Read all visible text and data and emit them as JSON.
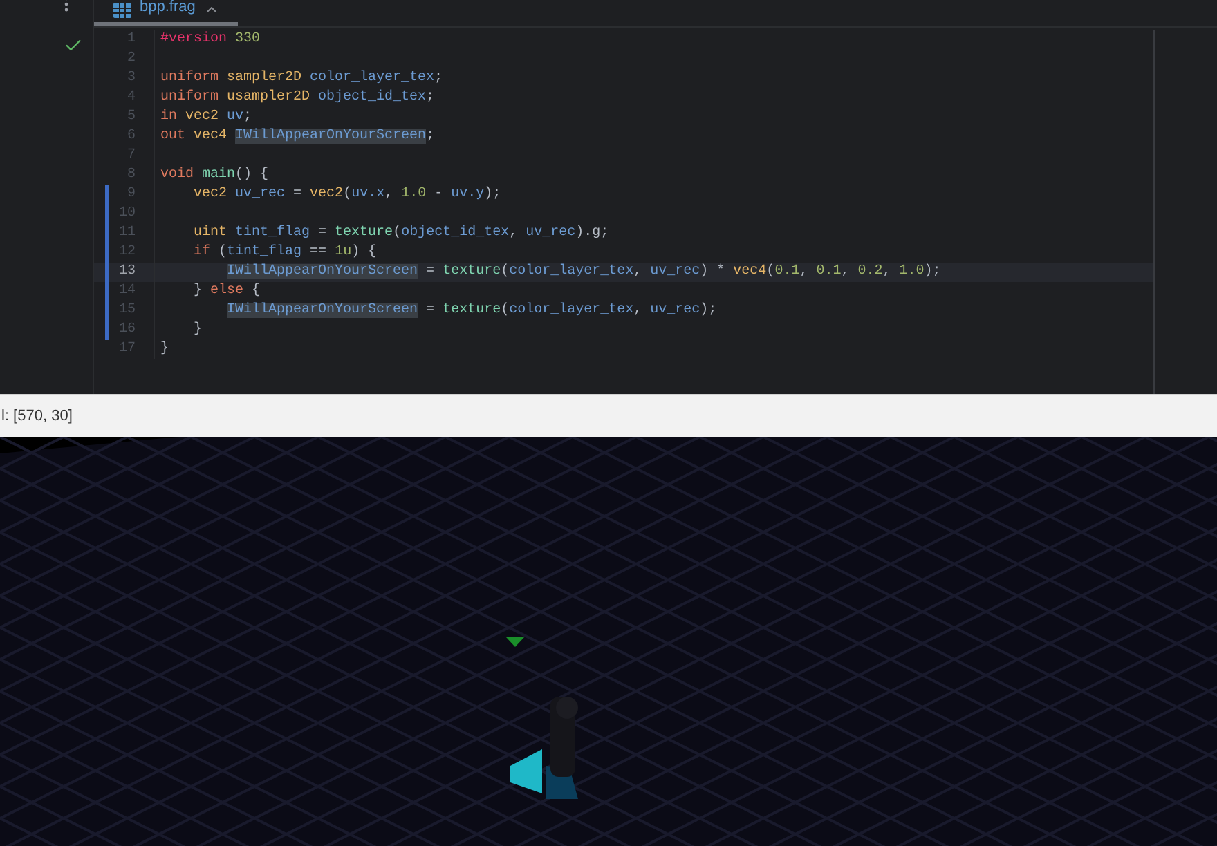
{
  "tab": {
    "title": "bpp.frag",
    "selected": true
  },
  "code_lines": [
    {
      "number": "1",
      "current": false,
      "changed": false,
      "tokens": [
        {
          "text": "#version ",
          "kind": "directive"
        },
        {
          "text": "330",
          "kind": "num"
        }
      ]
    },
    {
      "number": "2",
      "current": false,
      "changed": false
    },
    {
      "number": "3",
      "current": false,
      "changed": false,
      "tokens": [
        {
          "text": "uniform ",
          "kind": "kw"
        },
        {
          "text": "sampler2D ",
          "kind": "type"
        },
        {
          "text": "color_layer_tex",
          "kind": "id"
        },
        {
          "text": ";",
          "kind": "p"
        }
      ]
    },
    {
      "number": "4",
      "current": false,
      "changed": false,
      "tokens": [
        {
          "text": "uniform ",
          "kind": "kw"
        },
        {
          "text": "usampler2D ",
          "kind": "type"
        },
        {
          "text": "object_id_tex",
          "kind": "id"
        },
        {
          "text": ";",
          "kind": "p"
        }
      ]
    },
    {
      "number": "5",
      "current": false,
      "changed": false,
      "tokens": [
        {
          "text": "in ",
          "kind": "kw"
        },
        {
          "text": "vec2 ",
          "kind": "type"
        },
        {
          "text": "uv",
          "kind": "id"
        },
        {
          "text": ";",
          "kind": "p"
        }
      ]
    },
    {
      "number": "6",
      "current": false,
      "changed": false,
      "tokens": [
        {
          "text": "out ",
          "kind": "kw"
        },
        {
          "text": "vec4 ",
          "kind": "type"
        },
        {
          "text": "IWillAppearOnYourScreen",
          "kind": "mark"
        },
        {
          "text": ";",
          "kind": "p"
        }
      ]
    },
    {
      "number": "7",
      "current": false,
      "changed": false
    },
    {
      "number": "8",
      "current": false,
      "changed": false,
      "tokens": [
        {
          "text": "void ",
          "kind": "kw"
        },
        {
          "text": "main",
          "kind": "func"
        },
        {
          "text": "() {",
          "kind": "p"
        }
      ]
    },
    {
      "number": "9",
      "current": false,
      "changed": true,
      "tokens": [
        {
          "text": "    vec2 ",
          "kind": "type"
        },
        {
          "text": "uv_rec",
          "kind": "id"
        },
        {
          "text": " = ",
          "kind": "p"
        },
        {
          "text": "vec2",
          "kind": "type"
        },
        {
          "text": "(",
          "kind": "p"
        },
        {
          "text": "uv.x",
          "kind": "id"
        },
        {
          "text": ", ",
          "kind": "p"
        },
        {
          "text": "1.0",
          "kind": "num"
        },
        {
          "text": " - ",
          "kind": "p"
        },
        {
          "text": "uv.y",
          "kind": "id"
        },
        {
          "text": ");",
          "kind": "p"
        }
      ]
    },
    {
      "number": "10",
      "current": false,
      "changed": true
    },
    {
      "number": "11",
      "current": false,
      "changed": true,
      "tokens": [
        {
          "text": "    uint ",
          "kind": "type"
        },
        {
          "text": "tint_flag",
          "kind": "id"
        },
        {
          "text": " = ",
          "kind": "p"
        },
        {
          "text": "texture",
          "kind": "func"
        },
        {
          "text": "(",
          "kind": "p"
        },
        {
          "text": "object_id_tex",
          "kind": "id"
        },
        {
          "text": ", ",
          "kind": "p"
        },
        {
          "text": "uv_rec",
          "kind": "id"
        },
        {
          "text": ").g;",
          "kind": "p"
        }
      ]
    },
    {
      "number": "12",
      "current": false,
      "changed": true,
      "tokens": [
        {
          "text": "    if",
          "kind": "kw"
        },
        {
          "text": " (",
          "kind": "p"
        },
        {
          "text": "tint_flag",
          "kind": "id"
        },
        {
          "text": " == ",
          "kind": "p"
        },
        {
          "text": "1u",
          "kind": "num"
        },
        {
          "text": ") {",
          "kind": "p"
        }
      ]
    },
    {
      "number": "13",
      "current": true,
      "changed": true,
      "tokens": [
        {
          "text": "        IWillAppearOnYourScreen",
          "kind": "mark"
        },
        {
          "text": " = ",
          "kind": "p"
        },
        {
          "text": "texture",
          "kind": "func"
        },
        {
          "text": "(",
          "kind": "p"
        },
        {
          "text": "color_layer_tex",
          "kind": "id"
        },
        {
          "text": ", ",
          "kind": "p"
        },
        {
          "text": "uv_rec",
          "kind": "id"
        },
        {
          "text": ") * ",
          "kind": "p"
        },
        {
          "text": "vec4",
          "kind": "type"
        },
        {
          "text": "(",
          "kind": "p"
        },
        {
          "text": "0.1",
          "kind": "num"
        },
        {
          "text": ", ",
          "kind": "p"
        },
        {
          "text": "0.1",
          "kind": "num"
        },
        {
          "text": ", ",
          "kind": "p"
        },
        {
          "text": "0.2",
          "kind": "num"
        },
        {
          "text": ", ",
          "kind": "p"
        },
        {
          "text": "1.0",
          "kind": "num"
        },
        {
          "text": ");",
          "kind": "p"
        }
      ]
    },
    {
      "number": "14",
      "current": false,
      "changed": true,
      "tokens": [
        {
          "text": "    } ",
          "kind": "p"
        },
        {
          "text": "else",
          "kind": "kw"
        },
        {
          "text": " {",
          "kind": "p"
        }
      ]
    },
    {
      "number": "15",
      "current": false,
      "changed": true,
      "tokens": [
        {
          "text": "        IWillAppearOnYourScreen",
          "kind": "mark"
        },
        {
          "text": " = ",
          "kind": "p"
        },
        {
          "text": "texture",
          "kind": "func"
        },
        {
          "text": "(",
          "kind": "p"
        },
        {
          "text": "color_layer_tex",
          "kind": "id"
        },
        {
          "text": ", ",
          "kind": "p"
        },
        {
          "text": "uv_rec",
          "kind": "id"
        },
        {
          "text": ");",
          "kind": "p"
        }
      ]
    },
    {
      "number": "16",
      "current": false,
      "changed": true,
      "tokens": [
        {
          "text": "    }",
          "kind": "p"
        }
      ]
    },
    {
      "number": "17",
      "current": false,
      "changed": false,
      "tokens": [
        {
          "text": "}",
          "kind": "p"
        }
      ]
    }
  ],
  "status_bar": {
    "text": "l: [570, 30]"
  }
}
